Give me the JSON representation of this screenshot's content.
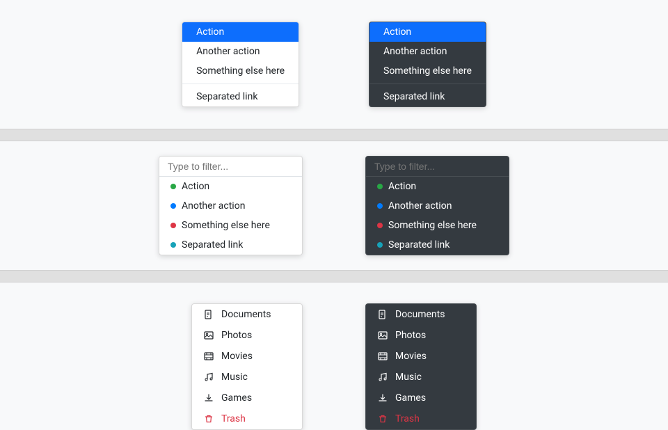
{
  "section1": {
    "light_dropdown": {
      "items": [
        {
          "label": "Action",
          "active": true
        },
        {
          "label": "Another action",
          "active": false
        },
        {
          "label": "Something else here",
          "active": false
        },
        {
          "label": "Separated link",
          "active": false,
          "divider_before": true
        }
      ]
    },
    "dark_dropdown": {
      "items": [
        {
          "label": "Action",
          "active": true
        },
        {
          "label": "Another action",
          "active": false
        },
        {
          "label": "Something else here",
          "active": false
        },
        {
          "label": "Separated link",
          "active": false,
          "divider_before": true
        }
      ]
    }
  },
  "section2": {
    "filter_placeholder": "Type to filter...",
    "light_filter": {
      "items": [
        {
          "label": "Action",
          "dot": "green"
        },
        {
          "label": "Another action",
          "dot": "blue"
        },
        {
          "label": "Something else here",
          "dot": "red"
        },
        {
          "label": "Separated link",
          "dot": "teal"
        }
      ]
    },
    "dark_filter": {
      "items": [
        {
          "label": "Action",
          "dot": "green"
        },
        {
          "label": "Another action",
          "dot": "blue"
        },
        {
          "label": "Something else here",
          "dot": "red"
        },
        {
          "label": "Separated link",
          "dot": "teal"
        }
      ]
    }
  },
  "section3": {
    "light_icon": {
      "items": [
        {
          "label": "Documents",
          "icon": "file"
        },
        {
          "label": "Photos",
          "icon": "photo"
        },
        {
          "label": "Movies",
          "icon": "film"
        },
        {
          "label": "Music",
          "icon": "music"
        },
        {
          "label": "Games",
          "icon": "download"
        },
        {
          "label": "Trash",
          "icon": "trash",
          "danger": true
        }
      ]
    },
    "dark_icon": {
      "items": [
        {
          "label": "Documents",
          "icon": "file"
        },
        {
          "label": "Photos",
          "icon": "photo"
        },
        {
          "label": "Movies",
          "icon": "film"
        },
        {
          "label": "Music",
          "icon": "music"
        },
        {
          "label": "Games",
          "icon": "download"
        },
        {
          "label": "Trash",
          "icon": "trash",
          "danger": true
        }
      ]
    }
  }
}
